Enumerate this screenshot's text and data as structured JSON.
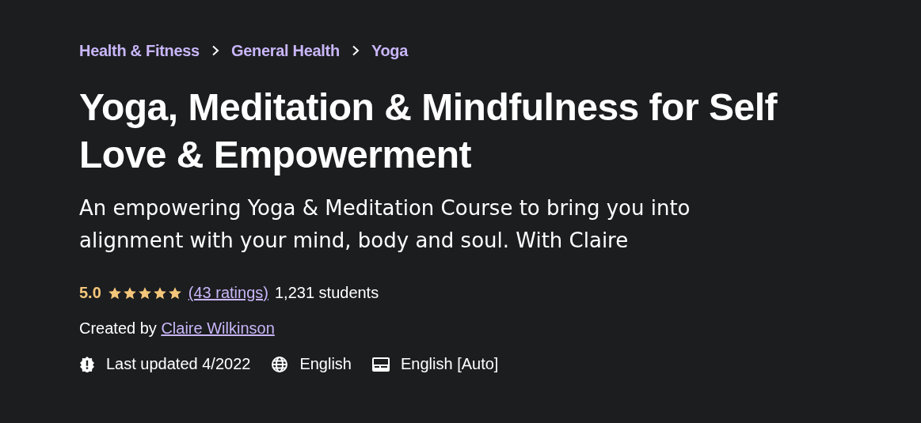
{
  "breadcrumb": [
    {
      "label": "Health & Fitness"
    },
    {
      "label": "General Health"
    },
    {
      "label": "Yoga"
    }
  ],
  "title": "Yoga, Meditation & Mindfulness for Self Love & Empowerment",
  "subtitle": "An empowering Yoga & Meditation Course to bring you into alignment with your mind, body and soul. With Claire",
  "rating": {
    "score": "5.0",
    "stars": 5,
    "ratings_link": "(43 ratings)",
    "students": "1,231 students"
  },
  "creator": {
    "prefix": "Created by",
    "name": "Claire Wilkinson"
  },
  "meta": [
    {
      "kind": "updated",
      "text": "Last updated 4/2022"
    },
    {
      "kind": "language",
      "text": "English"
    },
    {
      "kind": "captions",
      "text": "English [Auto]"
    }
  ]
}
